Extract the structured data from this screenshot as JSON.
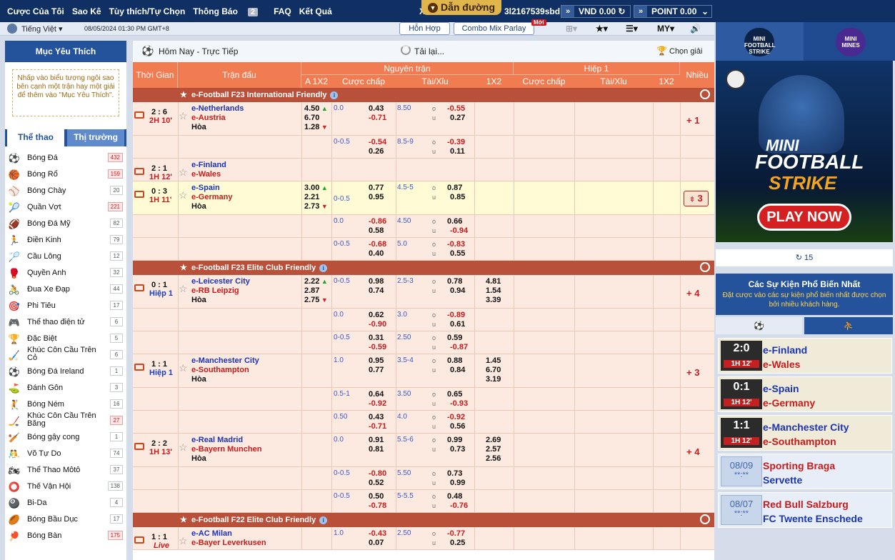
{
  "top": {
    "menu": [
      "Cược Của Tôi",
      "Sao Kê",
      "Tùy thích/Tự Chọn",
      "Thông Báo",
      "FAQ",
      "Kết Quả"
    ],
    "notif_count": "2",
    "guide": "Dẫn đường",
    "x_label": "X",
    "account": "3l2167539sbd",
    "currency": "VND",
    "balance": "0.00",
    "point_label": "POINT",
    "point_value": "0.00"
  },
  "sub": {
    "language": "Tiếng Việt",
    "datetime": "08/05/2024 01:30 PM GMT+8",
    "mixed": "Hỗn Hợp",
    "combo": "Combo Mix Parlay",
    "new_badge": "Mới",
    "my": "MY"
  },
  "left": {
    "fav_title": "Mục Yêu Thích",
    "fav_text": "Nhấp vào biểu tượng ngôi sao bên cạnh một trận hay một giải để thêm vào \"Mục Yêu Thích\".",
    "tab_sports": "Thể thao",
    "tab_market": "Thị trường",
    "sports": [
      {
        "name": "Bóng Đá",
        "count": "432",
        "hot": true,
        "icon": "⚽"
      },
      {
        "name": "Bóng Rổ",
        "count": "159",
        "hot": true,
        "icon": "🏀"
      },
      {
        "name": "Bóng Chày",
        "count": "20",
        "hot": false,
        "icon": "⚾"
      },
      {
        "name": "Quần Vợt",
        "count": "221",
        "hot": true,
        "icon": "🎾"
      },
      {
        "name": "Bóng Đá Mỹ",
        "count": "82",
        "hot": false,
        "icon": "🏈"
      },
      {
        "name": "Điền Kinh",
        "count": "79",
        "hot": false,
        "icon": "🏃"
      },
      {
        "name": "Cầu Lông",
        "count": "12",
        "hot": false,
        "icon": "🏸"
      },
      {
        "name": "Quyền Anh",
        "count": "32",
        "hot": false,
        "icon": "🥊"
      },
      {
        "name": "Đua Xe Đạp",
        "count": "44",
        "hot": false,
        "icon": "🚴"
      },
      {
        "name": "Phi Tiêu",
        "count": "17",
        "hot": false,
        "icon": "🎯"
      },
      {
        "name": "Thể thao điện tử",
        "count": "6",
        "hot": false,
        "icon": "🎮"
      },
      {
        "name": "Đặc Biệt",
        "count": "5",
        "hot": false,
        "icon": "🏆"
      },
      {
        "name": "Khúc Côn Cầu Trên Cỏ",
        "count": "6",
        "hot": false,
        "icon": "🏑"
      },
      {
        "name": "Bóng Đá Ireland",
        "count": "1",
        "hot": false,
        "icon": "⚽"
      },
      {
        "name": "Đánh Gôn",
        "count": "3",
        "hot": false,
        "icon": "⛳"
      },
      {
        "name": "Bóng Ném",
        "count": "16",
        "hot": false,
        "icon": "🤾"
      },
      {
        "name": "Khúc Côn Cầu Trên Băng",
        "count": "27",
        "hot": true,
        "icon": "🏒"
      },
      {
        "name": "Bóng gậy cong",
        "count": "1",
        "hot": false,
        "icon": "🏏"
      },
      {
        "name": "Võ Tự Do",
        "count": "74",
        "hot": false,
        "icon": "🤼"
      },
      {
        "name": "Thể Thao Môtô",
        "count": "37",
        "hot": false,
        "icon": "🏍"
      },
      {
        "name": "Thế Vận Hội",
        "count": "138",
        "hot": false,
        "icon": "⭕"
      },
      {
        "name": "Bi-Da",
        "count": "4",
        "hot": false,
        "icon": "🎱"
      },
      {
        "name": "Bóng Bầu Dục",
        "count": "17",
        "hot": false,
        "icon": "🏉"
      },
      {
        "name": "Bóng Bàn",
        "count": "175",
        "hot": true,
        "icon": "🏓"
      }
    ]
  },
  "main": {
    "title": "Hôm Nay - Trực Tiếp",
    "loading": "Tải lại...",
    "select_league": "Chọn giải",
    "headers": {
      "time": "Thời Gian",
      "match": "Trận đấu",
      "full": "Nguyên trận",
      "half": "Hiệp 1",
      "more": "Nhiều",
      "a1x2": "A 1X2",
      "hdp": "Cược chấp",
      "ou": "Tài/Xỉu",
      "x12": "1X2",
      "hdp2": "Cược chấp",
      "ou2": "Tài/Xỉu",
      "x12b": "1X2"
    },
    "leagues": [
      "e-Football F23 International Friendly",
      "e-Football F23 Elite Club Friendly",
      "e-Football F22 Elite Club Friendly"
    ],
    "matches": [
      {
        "score": "2 : 6",
        "time": "2H 10'",
        "home": "e-Netherlands",
        "away": "e-Austria",
        "draw": "Hòa",
        "a1": "4.50",
        "a2": "6.70",
        "a3": "1.28",
        "hcp": "0.0",
        "hh": "0.43",
        "ha": "-0.71",
        "ou": "8.50",
        "oo": "-0.55",
        "ouu": "0.27",
        "more": "+ 1"
      },
      {
        "hcp": "0-0.5",
        "hh": "-0.54",
        "ha": "0.26",
        "ou": "8.5-9",
        "oo": "-0.39",
        "ouu": "0.11"
      },
      {
        "score": "2 : 1",
        "time": "1H 12'",
        "home": "e-Finland",
        "away": "e-Wales"
      },
      {
        "score": "0 : 3",
        "time": "1H 11'",
        "home": "e-Spain",
        "away": "e-Germany",
        "draw": "Hòa",
        "a1": "3.00",
        "a2": "2.21",
        "a3": "2.73",
        "hcp": "0-0.5",
        "hh": "0.77",
        "ha": "0.95",
        "ou": "4.5-5",
        "oo": "0.87",
        "ouu": "0.85",
        "more": "3"
      },
      {
        "hcp": "0.0",
        "hh": "-0.86",
        "ha": "0.58",
        "ou": "4.50",
        "oo": "0.66",
        "ouu": "-0.94"
      },
      {
        "hcp": "0-0.5",
        "hh": "-0.68",
        "ha": "0.40",
        "ou": "5.0",
        "oo": "-0.83",
        "ouu": "0.55"
      },
      {
        "score": "0 : 1",
        "time": "Hiệp 1",
        "home": "e-Leicester City",
        "away": "e-RB Leipzig",
        "draw": "Hòa",
        "a1": "2.22",
        "a2": "2.87",
        "a3": "2.75",
        "hcp": "0-0.5",
        "hh": "0.98",
        "ha": "0.74",
        "ou": "2.5-3",
        "oo": "0.78",
        "ouu": "0.94",
        "x1": "4.81",
        "x2": "1.54",
        "x3": "3.39",
        "more": "+ 4"
      },
      {
        "hcp": "0.0",
        "hh": "0.62",
        "ha": "-0.90",
        "ou": "3.0",
        "oo": "-0.89",
        "ouu": "0.61"
      },
      {
        "hcp": "0-0.5",
        "hh": "0.31",
        "ha": "-0.59",
        "ou": "2.50",
        "oo": "0.59",
        "ouu": "-0.87"
      },
      {
        "score": "1 : 1",
        "time": "Hiệp 1",
        "home": "e-Manchester City",
        "away": "e-Southampton",
        "draw": "Hòa",
        "hcp": "1.0",
        "hh": "0.95",
        "ha": "0.77",
        "ou": "3.5-4",
        "oo": "0.88",
        "ouu": "0.84",
        "x1": "1.45",
        "x2": "6.70",
        "x3": "3.19",
        "more": "+ 3"
      },
      {
        "hcp": "0.5-1",
        "hh": "0.64",
        "ha": "-0.92",
        "ou": "3.50",
        "oo": "0.65",
        "ouu": "-0.93"
      },
      {
        "hcp": "0.50",
        "hh": "0.43",
        "ha": "-0.71",
        "ou": "4.0",
        "oo": "-0.92",
        "ouu": "0.56"
      },
      {
        "score": "2 : 2",
        "time": "1H 13'",
        "home": "e-Real Madrid",
        "away": "e-Bayern Munchen",
        "draw": "Hòa",
        "hcp": "0.0",
        "hh": "0.91",
        "ha": "0.81",
        "ou": "5.5-6",
        "oo": "0.99",
        "ouu": "0.73",
        "x1": "2.69",
        "x2": "2.57",
        "x3": "2.56",
        "more": "+ 4"
      },
      {
        "hcp": "0-0.5",
        "hh": "-0.80",
        "ha": "0.52",
        "ou": "5.50",
        "oo": "0.73",
        "ouu": "0.99"
      },
      {
        "hcp": "0-0.5",
        "hh": "0.50",
        "ha": "-0.78",
        "ou": "5-5.5",
        "oo": "0.48",
        "ouu": "-0.76"
      },
      {
        "score": "1 : 1",
        "time": "Live",
        "home": "e-AC Milan",
        "away": "e-Bayer Leverkusen",
        "hcp": "1.0",
        "hh": "-0.43",
        "ha": "0.07",
        "ou": "2.50",
        "oo": "-0.77",
        "ouu": "0.25"
      }
    ],
    "o_mark": "o",
    "u_mark": "u"
  },
  "right": {
    "game1": "MINI FOOTBALL STRIKE",
    "game2": "MINI MINES",
    "banner_line1": "MINI",
    "banner_line2": "FOOTBALL",
    "banner_line3": "STRIKE",
    "banner_cta": "PLAY NOW",
    "count": "15",
    "pop_title": "Các Sự Kiện Phổ Biến Nhất",
    "pop_sub": "Đặt cược vào các sự kiện phổ biến nhất được chọn bởi nhiều khách hàng.",
    "cards": [
      {
        "score": "2:0",
        "time": "1H 12'",
        "home": "e-Finland",
        "away": "e-Wales"
      },
      {
        "score": "0:1",
        "time": "1H 12'",
        "home": "e-Spain",
        "away": "e-Germany"
      },
      {
        "score": "1:1",
        "time": "1H 12'",
        "home": "e-Manchester City",
        "away": "e-Southampton"
      },
      {
        "date": "08/09",
        "clock": "**:**",
        "home": "Sporting Braga",
        "away": "Servette"
      },
      {
        "date": "08/07",
        "clock": "**:**",
        "home": "Red Bull Salzburg",
        "away": "FC Twente Enschede"
      }
    ]
  }
}
